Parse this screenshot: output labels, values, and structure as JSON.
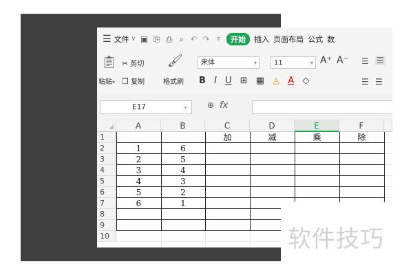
{
  "menubar": {
    "file_label": "文件",
    "start_label": "开始",
    "insert_label": "插入",
    "layout_label": "页面布局",
    "formula_label": "公式",
    "data_label": "数"
  },
  "ribbon": {
    "paste_label": "粘贴",
    "cut_label": "剪切",
    "copy_label": "复制",
    "format_painter_label": "格式刷",
    "font_name": "宋体",
    "font_size": "11"
  },
  "formula_bar": {
    "cell_ref": "E17",
    "fx_label": "fx",
    "formula_value": ""
  },
  "sheet": {
    "columns": [
      "A",
      "B",
      "C",
      "D",
      "E",
      "F"
    ],
    "selected_column": "E",
    "rows": [
      "1",
      "2",
      "3",
      "4",
      "5",
      "6",
      "7",
      "8",
      "9",
      "10"
    ],
    "cells": {
      "C1": "加",
      "D1": "减",
      "E1": "乘",
      "F1": "除",
      "A2": "1",
      "B2": "6",
      "A3": "2",
      "B3": "5",
      "A4": "3",
      "B4": "4",
      "A5": "4",
      "B5": "3",
      "A6": "5",
      "B6": "2",
      "A7": "6",
      "B7": "1"
    }
  },
  "watermark": "软件技巧",
  "colors": {
    "accent": "#1aa454",
    "dark_background": "#3f3f3f"
  }
}
